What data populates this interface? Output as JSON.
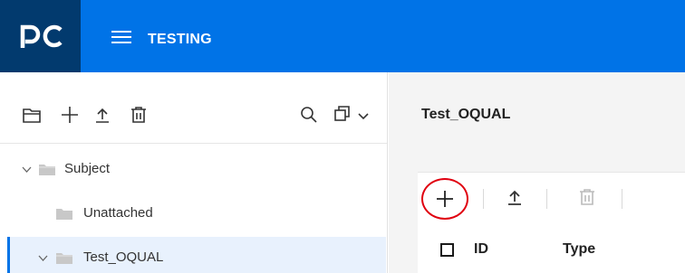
{
  "header": {
    "logo_text": "PC",
    "app_title": "TESTING"
  },
  "sidebar": {
    "toolbar_icons": [
      "folder-icon",
      "add-icon",
      "upload-icon",
      "delete-icon",
      "search-icon",
      "copy-icon",
      "chevron-down-icon"
    ],
    "tree": [
      {
        "label": "Subject",
        "expanded": true
      },
      {
        "label": "Unattached"
      },
      {
        "label": "Test_OQUAL",
        "expanded": true,
        "selected": true
      }
    ]
  },
  "main": {
    "title": "Test_OQUAL",
    "toolbar_icons": [
      "add-icon",
      "upload-icon",
      "delete-icon"
    ],
    "columns": [
      "ID",
      "Type"
    ]
  },
  "colors": {
    "topbar": "#0073e7",
    "logo_bg": "#023a6e",
    "highlight": "#e00010",
    "selected_row": "#e8f1fd"
  }
}
